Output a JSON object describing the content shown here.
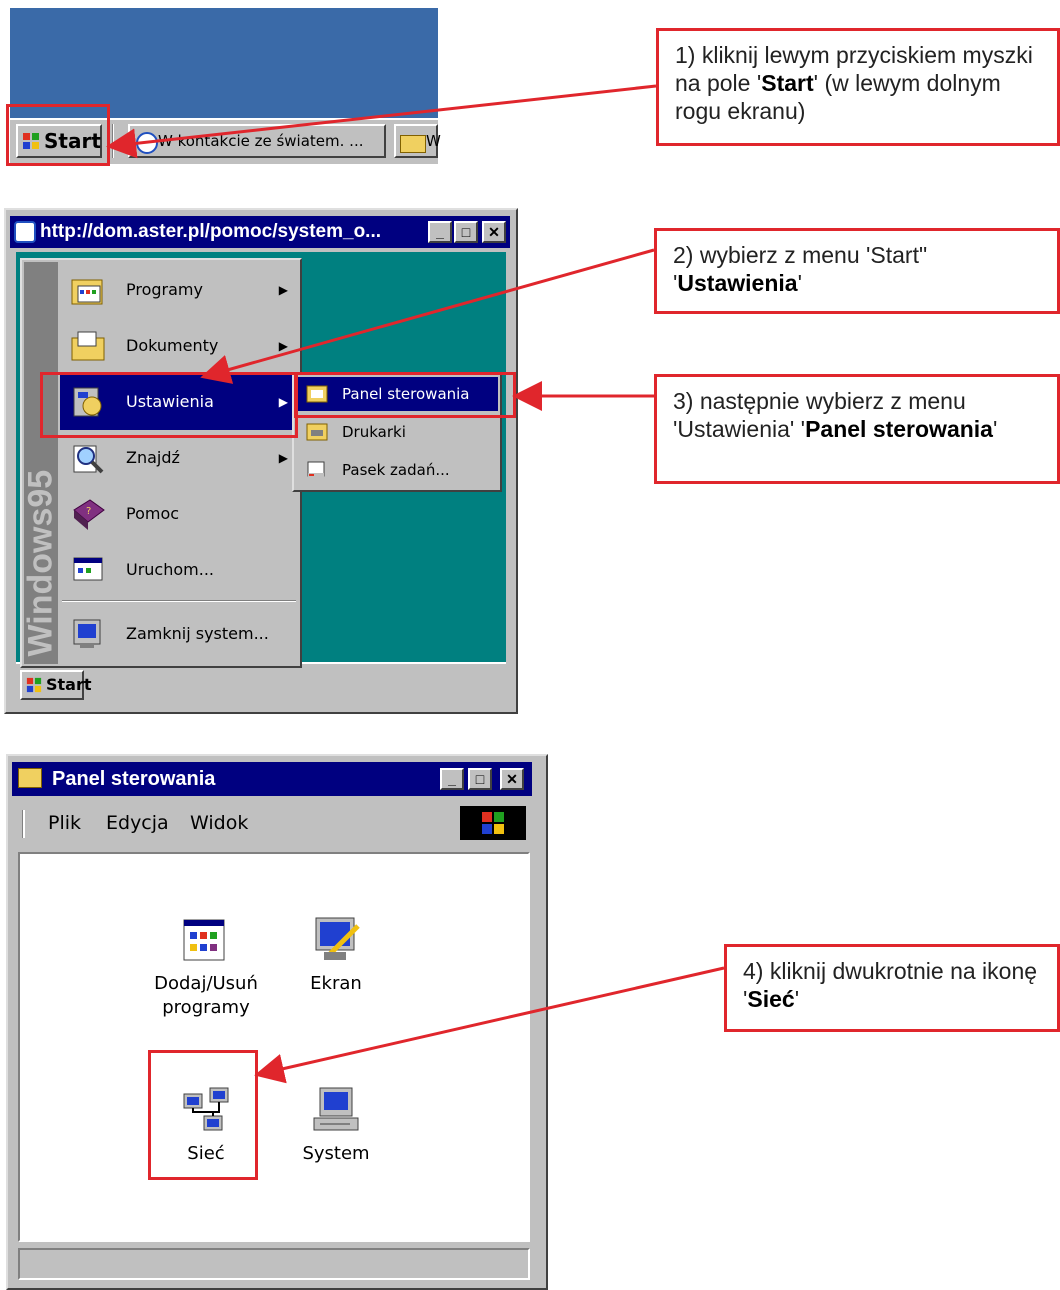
{
  "section1": {
    "start_label": "Start",
    "task1_label": "W kontakcie ze światem. ...",
    "task2_label": "W"
  },
  "callouts": {
    "c1": {
      "pre": "1) kliknij lewym przyciskiem myszki na pole '",
      "bold": "Start",
      "post": "' (w lewym dolnym rogu ekranu)"
    },
    "c2": {
      "pre": "2) wybierz z menu 'Start\" '",
      "bold": "Ustawienia",
      "post": "'"
    },
    "c3": {
      "pre": "3) następnie wybierz z menu 'Ustawienia' '",
      "bold": "Panel sterowania",
      "post": "'"
    },
    "c4": {
      "pre": "4) kliknij dwukrotnie na ikonę '",
      "bold": "Sieć",
      "post": "'"
    }
  },
  "window2": {
    "title": "http://dom.aster.pl/pomoc/system_o...",
    "sidebar_text": "Windows95",
    "start_label": "Start",
    "menu_items": [
      {
        "label": "Programy",
        "icon": "programs-folder-icon"
      },
      {
        "label": "Dokumenty",
        "icon": "documents-folder-icon"
      },
      {
        "label": "Ustawienia",
        "icon": "settings-icon"
      },
      {
        "label": "Znajdź",
        "icon": "find-magnifier-icon"
      },
      {
        "label": "Pomoc",
        "icon": "help-book-icon"
      },
      {
        "label": "Uruchom...",
        "icon": "run-icon"
      },
      {
        "label": "Zamknij system...",
        "icon": "shutdown-icon"
      }
    ],
    "submenu_items": [
      {
        "label": "Panel sterowania",
        "icon": "control-panel-icon"
      },
      {
        "label": "Drukarki",
        "icon": "printers-icon"
      },
      {
        "label": "Pasek zadań...",
        "icon": "taskbar-icon"
      }
    ]
  },
  "window3": {
    "title": "Panel sterowania",
    "menu": [
      "Plik",
      "Edycja",
      "Widok"
    ],
    "icons": [
      {
        "label": "Dodaj/Usuń programy",
        "icon": "add-remove-programs-icon"
      },
      {
        "label": "Ekran",
        "icon": "display-icon"
      },
      {
        "label": "Sieć",
        "icon": "network-icon"
      },
      {
        "label": "System",
        "icon": "system-icon"
      }
    ]
  },
  "colors": {
    "accent": "#e0262c",
    "titlebar": "#000080",
    "desktop": "#008080",
    "face": "#c0c0c0"
  }
}
